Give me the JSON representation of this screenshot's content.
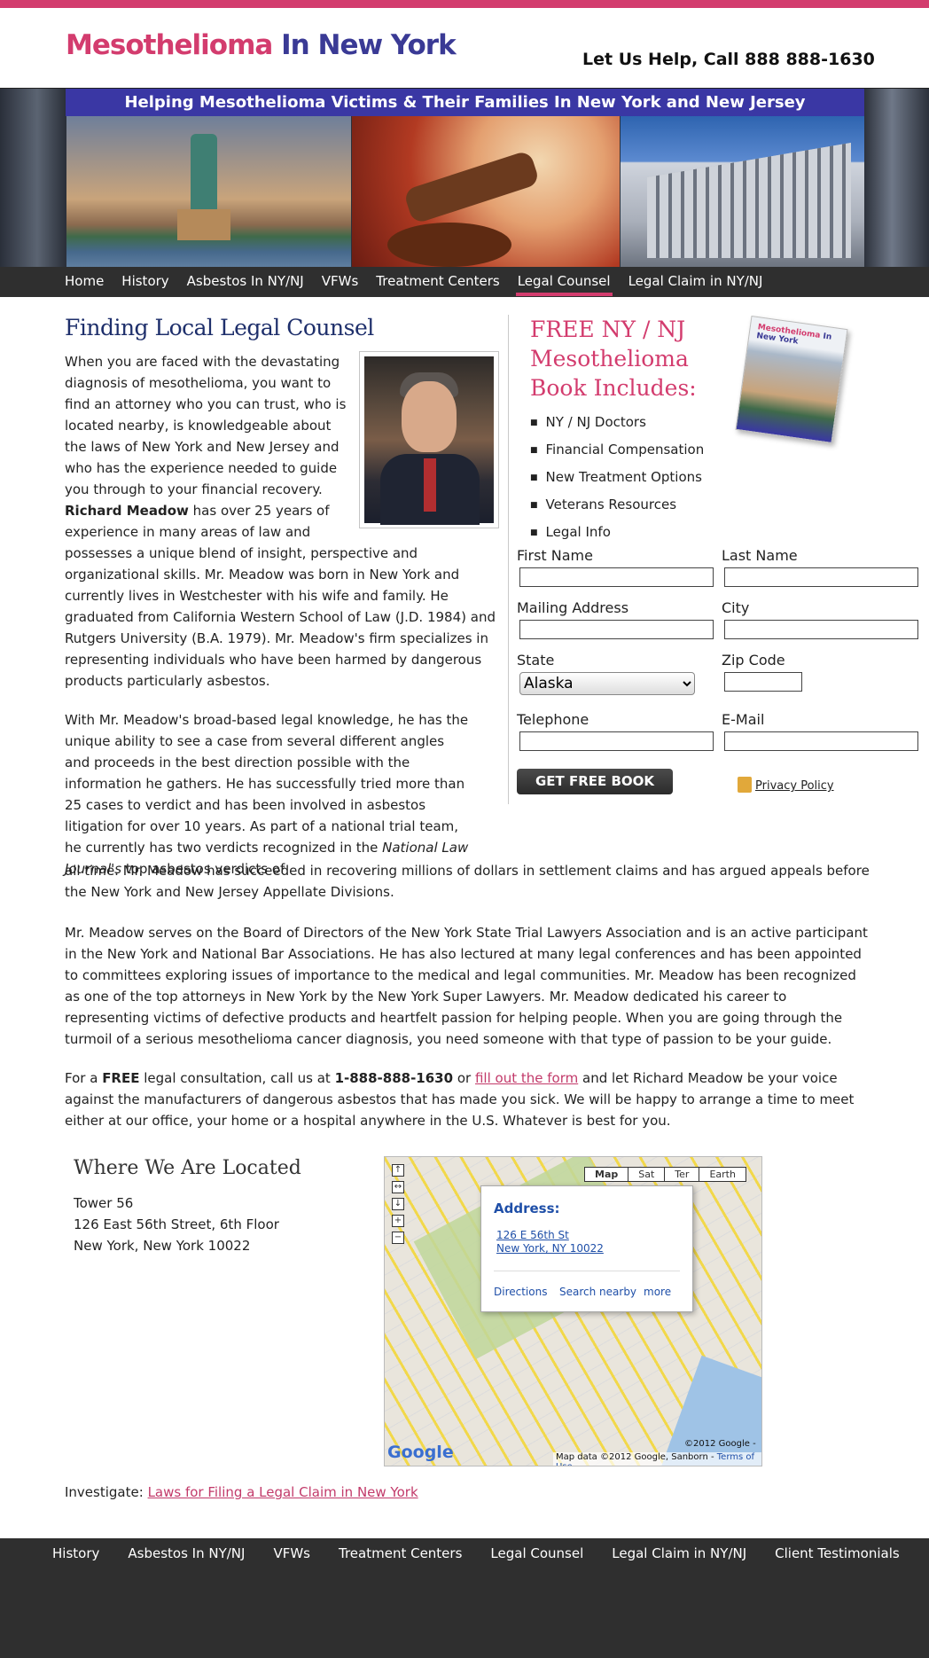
{
  "header": {
    "logo_part1": "Mesothelioma",
    "logo_part2": "In New York",
    "call": "Let Us Help, Call 888 888-1630"
  },
  "banner": {
    "tagline": "Helping Mesothelioma Victims & Their Families In New York and New Jersey"
  },
  "nav": {
    "items": [
      "Home",
      "History",
      "Asbestos In NY/NJ",
      "VFWs",
      "Treatment Centers",
      "Legal Counsel",
      "Legal Claim in NY/NJ"
    ],
    "active": "Legal Counsel"
  },
  "article": {
    "title": "Finding Local Legal Counsel",
    "p1_a": "When you are faced with the devastating diagnosis of mesothelioma, you want to find an attorney who you can trust, who is located nearby, is knowledgeable about the laws of New York and New Jersey and who has the experience needed to guide you through to your financial recovery.",
    "p1_name": "Richard Meadow",
    "p1_b": "has over 25 years of experience in many areas of law and possesses a unique blend of insight, perspective and organizational skills. Mr. Meadow was born in New York and currently lives in Westchester with his wife and family. He graduated from California Western School of Law (J.D. 1984) and Rutgers University (B.A. 1979). Mr. Meadow's firm specializes in representing individuals who have been harmed by dangerous products particularly asbestos.",
    "p2_a": "With Mr. Meadow's broad-based legal knowledge, he has the unique ability to see a case from several different angles and proceeds in the best direction possible with the information he gathers. He has successfully tried more than 25 cases to verdict and has been involved in asbestos litigation for over 10 years. As part of a national trial team, he currently has two verdicts recognized in the",
    "p2_journal": "National Law Journal's",
    "p2_b": "top asbestos verdicts of",
    "p2_c": "all time. Mr. Meadow has succeeded in recovering millions of dollars in settlement claims and has argued appeals before the New York and New Jersey Appellate Divisions.",
    "p3": "Mr. Meadow serves on the Board of Directors of the New York State Trial Lawyers Association and is an active participant in the New York and National Bar Associations. He has also lectured at many legal conferences and has been appointed to committees exploring issues of importance to the medical and legal communities. Mr. Meadow has been recognized as one of the top attorneys in New York by the New York Super Lawyers. Mr. Meadow dedicated his career to representing victims of defective products and heartfelt passion for helping people. When you are going through the turmoil of a serious mesothelioma cancer diagnosis, you need someone with that type of passion to be your guide.",
    "p4_a": "For a",
    "p4_free": "FREE",
    "p4_b": "legal consultation, call us at",
    "p4_phone": "1-888-888-1630",
    "p4_c": "or",
    "p4_link": "fill out the form",
    "p4_d": "and let Richard Meadow be your voice against the manufacturers of dangerous asbestos that has made you sick. We will be happy to arrange a time to meet either at our office, your home or a hospital anywhere in the U.S. Whatever is best for you."
  },
  "promo": {
    "title": "FREE NY / NJ Mesothelioma Book Includes:",
    "book_logo_1": "Mesothelioma",
    "book_logo_2": "In New York",
    "bullets": [
      "NY / NJ Doctors",
      "Financial Compensation",
      "New Treatment Options",
      "Veterans Resources",
      "Legal Info"
    ]
  },
  "form": {
    "first_name": "First Name",
    "last_name": "Last Name",
    "mailing": "Mailing Address",
    "city": "City",
    "state": "State",
    "state_value": "Alaska",
    "zip": "Zip Code",
    "telephone": "Telephone",
    "email": "E-Mail",
    "submit": "GET FREE BOOK",
    "privacy": "Privacy Policy"
  },
  "location": {
    "heading": "Where We Are Located",
    "line1": "Tower 56",
    "line2": "126 East 56th Street, 6th Floor",
    "line3": "New York, New York 10022"
  },
  "map": {
    "types": [
      "Map",
      "Sat",
      "Ter",
      "Earth"
    ],
    "info_heading": "Address:",
    "info_line1": "126 E 56th St",
    "info_line2": "New York, NY 10022",
    "directions": "Directions",
    "search_nearby": "Search nearby",
    "more": "more",
    "copyright": "Map data ©2012 Google, Sanborn -",
    "terms": "Terms of Use",
    "copyright2": "©2012 Google -",
    "google": "Google"
  },
  "investigate": {
    "label": "Investigate:",
    "link": "Laws for Filing a Legal Claim in New York"
  },
  "footer": {
    "items": [
      "History",
      "Asbestos In NY/NJ",
      "VFWs",
      "Treatment Centers",
      "Legal Counsel",
      "Legal Claim in NY/NJ",
      "Client Testimonials"
    ]
  },
  "colors": {
    "accent": "#d33c6e",
    "brand_blue": "#3a3a95",
    "nav_bg": "#2f2f2f"
  }
}
